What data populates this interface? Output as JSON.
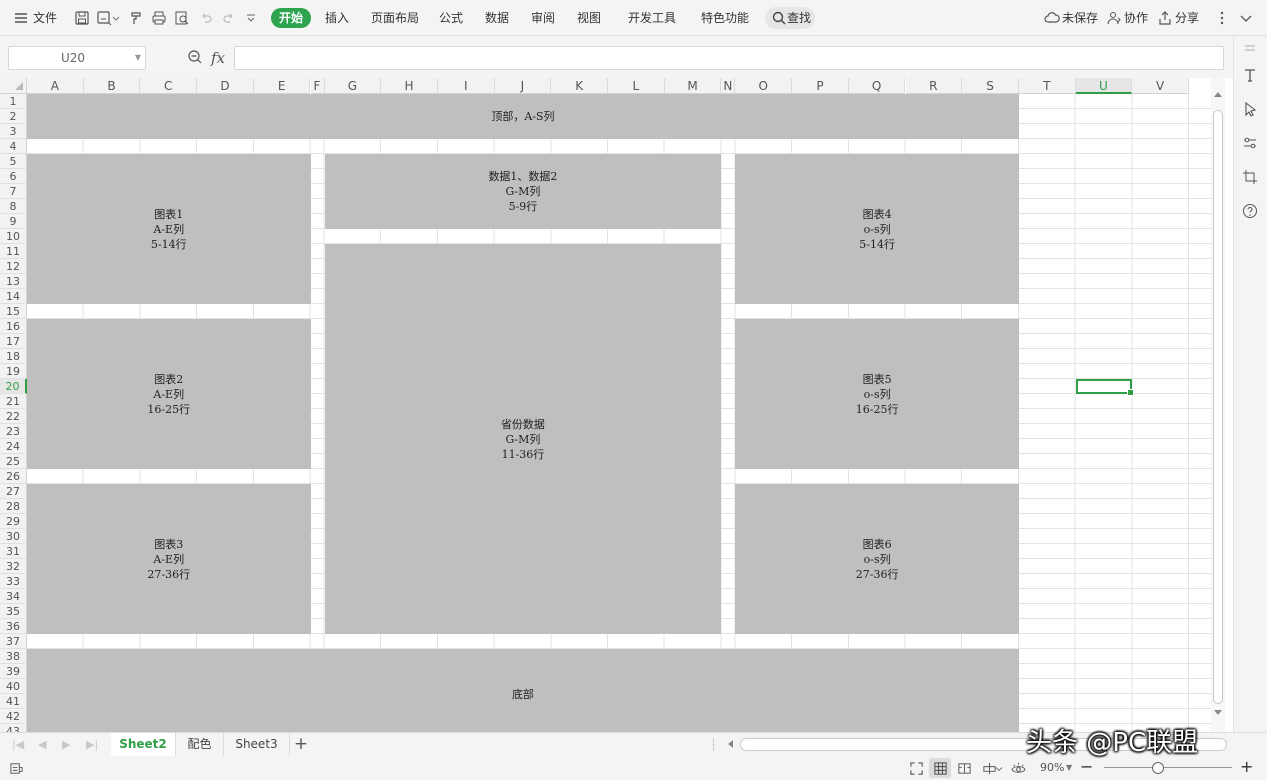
{
  "menubar": {
    "file": "文件",
    "tabs": [
      "开始",
      "插入",
      "页面布局",
      "公式",
      "数据",
      "审阅",
      "视图",
      "开发工具",
      "特色功能"
    ],
    "search": "查找",
    "unsaved": "未保存",
    "collab": "协作",
    "share": "分享"
  },
  "formulabar": {
    "cell_ref": "U20",
    "fx": "fx",
    "value": ""
  },
  "grid": {
    "columns": [
      "A",
      "B",
      "C",
      "D",
      "E",
      "F",
      "G",
      "H",
      "I",
      "J",
      "K",
      "L",
      "M",
      "N",
      "O",
      "P",
      "Q",
      "R",
      "S",
      "T",
      "U",
      "V"
    ],
    "rows": [
      "1",
      "2",
      "3",
      "4",
      "5",
      "6",
      "7",
      "8",
      "9",
      "10",
      "11",
      "12",
      "13",
      "14",
      "15",
      "16",
      "17",
      "18",
      "19",
      "20",
      "21",
      "22",
      "23",
      "24",
      "25",
      "26",
      "27",
      "28",
      "29",
      "30",
      "31",
      "32",
      "33",
      "34",
      "35",
      "36",
      "37",
      "38",
      "39",
      "40",
      "41",
      "42",
      "43"
    ],
    "selected_column": "U",
    "selected_row": "20",
    "blocks": {
      "top": "顶部，A-S列",
      "data12": "数据1、数据2\nG-M列\n5-9行",
      "chart1": "图表1\nA-E列\n5-14行",
      "chart2": "图表2\nA-E列\n16-25行",
      "chart3": "图表3\nA-E列\n27-36行",
      "province": "省份数据\nG-M列\n11-36行",
      "chart4": "图表4\no-s列\n5-14行",
      "chart5": "图表5\no-s列\n16-25行",
      "chart6": "图表6\no-s列\n27-36行",
      "bottom": "底部"
    }
  },
  "sheets": {
    "tabs": [
      "Sheet2",
      "配色",
      "Sheet3"
    ],
    "active": "Sheet2",
    "add": "+"
  },
  "statusbar": {
    "zoom": "90%",
    "zoom_value": 90,
    "minus": "−",
    "plus": "+"
  },
  "watermark": "头条 @PC联盟"
}
